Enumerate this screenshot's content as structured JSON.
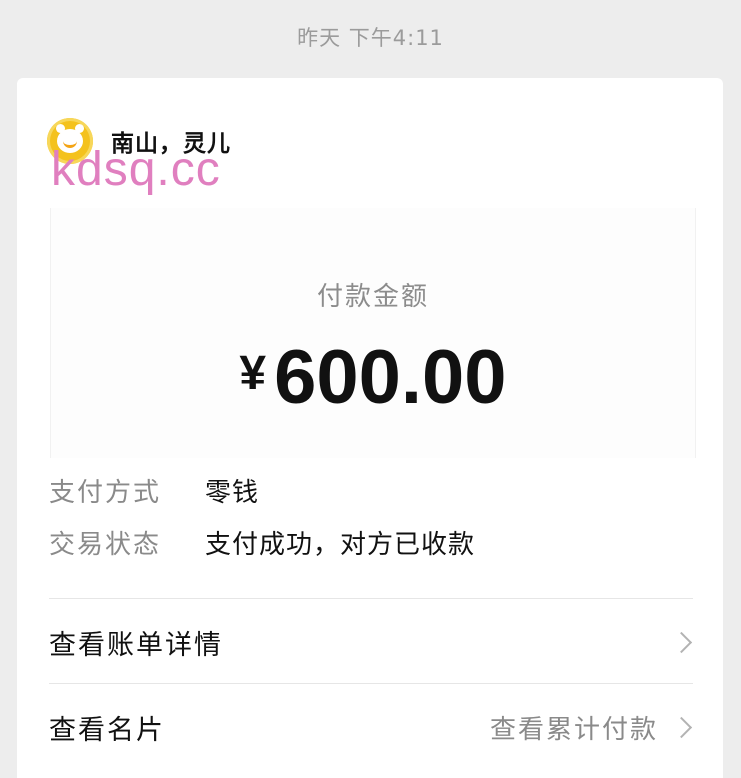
{
  "header": {
    "timestamp": "昨天 下午4:11"
  },
  "merchant": {
    "name": "南山，灵儿",
    "avatar_icon": "clock-avatar-icon",
    "avatar_color": "#f4c21d"
  },
  "watermark": {
    "text": "kdsq.cc",
    "color": "#e07fbf"
  },
  "payment": {
    "amount_label": "付款金额",
    "currency_symbol": "¥",
    "amount": "600.00"
  },
  "details": [
    {
      "key": "支付方式",
      "value": "零钱"
    },
    {
      "key": "交易状态",
      "value": "支付成功，对方已收款"
    }
  ],
  "links": {
    "bill_detail": {
      "label": "查看账单详情",
      "icon": "chevron-right-icon"
    },
    "view_card": {
      "label": "查看名片",
      "extra": "查看累计付款",
      "icon": "chevron-right-icon"
    }
  }
}
